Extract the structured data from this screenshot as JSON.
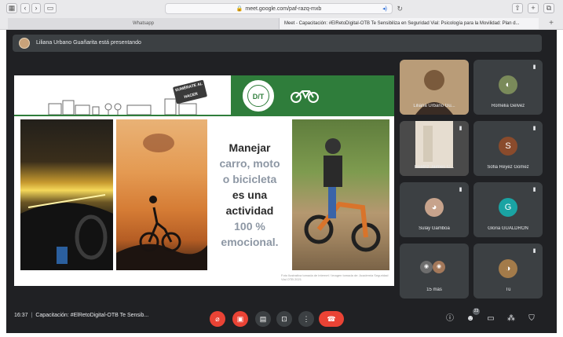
{
  "browser": {
    "url": "meet.google.com/paf-razq-mxb",
    "tabs": [
      {
        "label": "Whatsapp"
      },
      {
        "label": "Meet - Capacitación: #ElRetoDigital-OTB Te Sensibiliza en Seguridad Vial: Psicología para la Movilidad: Plan d..."
      }
    ]
  },
  "presenter": {
    "text": "Liliana Urbano Guañarita está presentando"
  },
  "slide": {
    "badge_text": "SUMÉRATE AL HACER",
    "logo_text": "D/T",
    "text_lines": [
      {
        "text": "Manejar",
        "style": "dark"
      },
      {
        "text": "carro, moto",
        "style": "gray"
      },
      {
        "text": "o bicicleta",
        "style": "gray"
      },
      {
        "text": "es una",
        "style": "dark"
      },
      {
        "text": "actividad",
        "style": "dark"
      },
      {
        "text": "100 %",
        "style": "gray"
      },
      {
        "text": "emocional.",
        "style": "gray"
      }
    ],
    "credit": "Foto Ilustrativa tomada de internet / Imagen tomada de: Academia Seguridad Vial OTB 2021"
  },
  "participants": [
    {
      "name": "Liliana Urbano Gu...",
      "type": "video",
      "color": "#b99c78"
    },
    {
      "name": "Romelia Gelvez",
      "type": "photo",
      "color": "#7a8a5a"
    },
    {
      "name": "Beatriz Jaimes C...",
      "type": "video",
      "color": "#e6ddd0"
    },
    {
      "name": "Sofia Reyez Gomez",
      "type": "initial",
      "initial": "S",
      "color": "#8a4b2c"
    },
    {
      "name": "Sulay Gamboa",
      "type": "photo",
      "color": "#c7a38c"
    },
    {
      "name": "Gloria GUALDRON",
      "type": "initial",
      "initial": "G",
      "color": "#1aa3a3"
    },
    {
      "name": "15 más",
      "type": "group",
      "color": "#6d6d6d"
    },
    {
      "name": "Tú",
      "type": "photo",
      "color": "#a37b4a"
    }
  ],
  "bottom_bar": {
    "time": "16:37",
    "meeting_title": "Capacitación: #ElRetoDigital-OTB Te Sensib...",
    "people_count": "23"
  },
  "icons": {
    "mic": "mic-off-icon",
    "camera": "camera-off-icon",
    "captions": "captions-icon",
    "present": "present-icon",
    "more": "more-vert-icon",
    "hangup": "hangup-icon",
    "info": "info-icon",
    "people": "people-icon",
    "chat": "chat-icon",
    "activities": "activities-icon",
    "security": "shield-icon"
  }
}
